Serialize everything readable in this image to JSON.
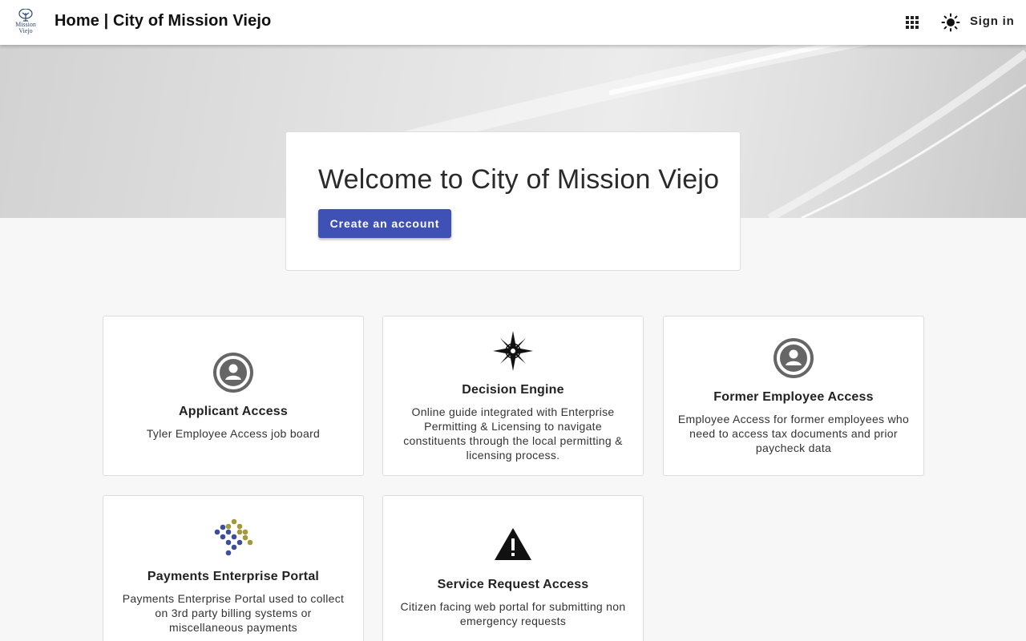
{
  "header": {
    "logo_line1": "Mission",
    "logo_line2": "Viejo",
    "title": "Home | City of Mission Viejo",
    "apps_icon": "apps-grid-icon",
    "theme_icon": "brightness-icon",
    "signin_label": "Sign in"
  },
  "welcome": {
    "title": "Welcome to City of Mission Viejo",
    "button_label": "Create an account",
    "button_color": "#3f51b5"
  },
  "apps": [
    {
      "icon": "account-circle-icon",
      "name": "Applicant Access",
      "description": "Tyler Employee Access job board"
    },
    {
      "icon": "compass-star-icon",
      "name": "Decision Engine",
      "description": "Online guide integrated with Enterprise Permitting & Licensing to navigate constituents through the local permitting & licensing process."
    },
    {
      "icon": "account-circle-icon",
      "name": "Former Employee Access",
      "description": "Employee Access for former employees who need to access tax documents and prior paycheck data"
    },
    {
      "icon": "dots-diamond-icon",
      "name": "Payments Enterprise Portal",
      "description": "Payments Enterprise Portal used to collect on 3rd party billing systems or miscellaneous payments"
    },
    {
      "icon": "warning-icon",
      "name": "Service Request Access",
      "description": "Citizen facing web portal for submitting non emergency requests"
    }
  ]
}
